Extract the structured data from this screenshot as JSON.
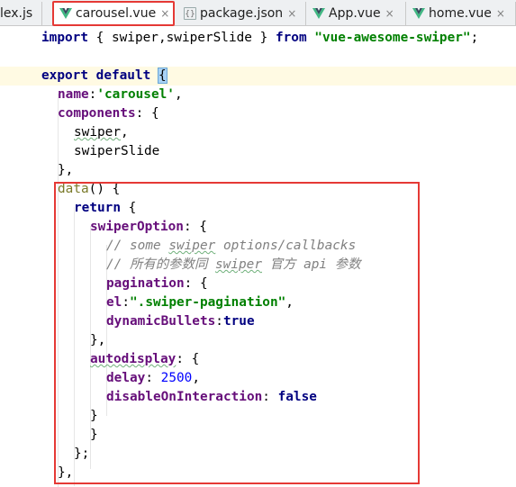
{
  "tabs": [
    {
      "label": "lex.js",
      "icon": "js-file-icon",
      "active": false
    },
    {
      "label": "carousel.vue",
      "icon": "vue-icon",
      "active": true
    },
    {
      "label": "package.json",
      "icon": "json-file-icon",
      "active": false
    },
    {
      "label": "App.vue",
      "icon": "vue-icon",
      "active": false
    },
    {
      "label": "home.vue",
      "icon": "vue-icon",
      "active": false
    }
  ],
  "close_glyph": "×",
  "colors": {
    "highlight_box": "#e53935",
    "vue_green": "#41b883",
    "vue_dark": "#35495e",
    "current_line": "#fffae3"
  },
  "code": {
    "l1": {
      "kw": "import",
      "p1": " { ",
      "w1": "swiper",
      "p2": ",",
      "w2": "swiperSlide",
      "p3": " } ",
      "kw2": "from",
      "p4": " ",
      "str": "\"vue-awesome-swiper\"",
      "p5": ";"
    },
    "l3": {
      "kw": "export",
      "p1": " ",
      "kw2": "default",
      "p2": " ",
      "brace": "{"
    },
    "l4": {
      "prop": "name",
      "p1": ":",
      "str": "'carousel'",
      "p2": ","
    },
    "l5": {
      "prop": "components",
      "p1": ": {"
    },
    "l6": {
      "w": "swiper",
      "p1": ","
    },
    "l7": {
      "w": "swiperSlide"
    },
    "l8": {
      "t": "},"
    },
    "l9": {
      "fn": "data",
      "p1": "() {"
    },
    "l10": {
      "kw": "return",
      "p1": " {"
    },
    "l11": {
      "prop": "swiperOption",
      "p1": ": {"
    },
    "l12": {
      "c1": "// some ",
      "cw": "swiper",
      "c2": " options/callbacks"
    },
    "l13": {
      "c1": "// 所有的参数同 ",
      "cw": "swiper",
      "c2": " 官方 api 参数"
    },
    "l14": {
      "prop": "pagination",
      "p1": ": {"
    },
    "l15": {
      "prop": "el",
      "p1": ":",
      "str": "\".swiper-pagination\"",
      "p2": ","
    },
    "l16": {
      "prop": "dynamicBullets",
      "p1": ":",
      "kw": "true"
    },
    "l17": {
      "t": "},"
    },
    "l18": {
      "prop": "autodisplay",
      "p1": ": {"
    },
    "l19": {
      "prop": "delay",
      "p1": ": ",
      "num": "2500",
      "p2": ","
    },
    "l20": {
      "prop": "disableOnInteraction",
      "p1": ": ",
      "kw": "false"
    },
    "l21": {
      "t": "}"
    },
    "l22": {
      "t": "}"
    },
    "l23": {
      "t": "};"
    },
    "l24": {
      "t": "},"
    }
  }
}
